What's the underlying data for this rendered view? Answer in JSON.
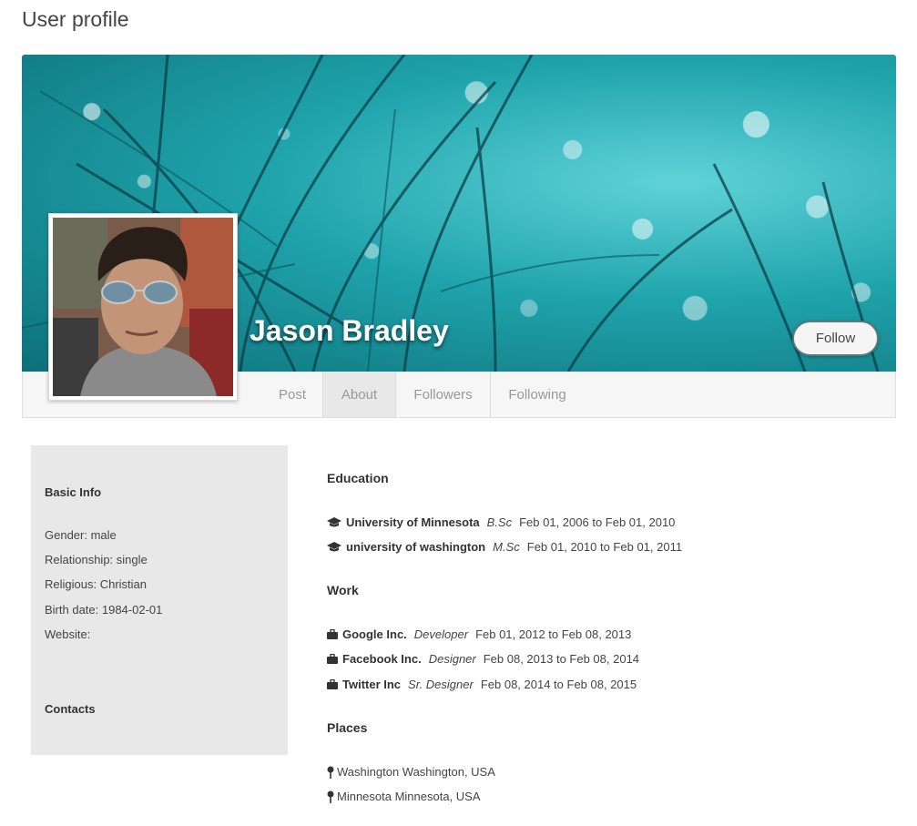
{
  "page": {
    "title": "User profile"
  },
  "profile": {
    "name": "Jason Bradley",
    "follow_label": "Follow"
  },
  "tabs": [
    {
      "label": "Post",
      "active": false
    },
    {
      "label": "About",
      "active": true
    },
    {
      "label": "Followers",
      "active": false
    },
    {
      "label": "Following",
      "active": false
    }
  ],
  "sidebar": {
    "basic_info_heading": "Basic Info",
    "gender": "Gender: male",
    "relationship": "Relationship: single",
    "religious": "Religious: Christian",
    "birth_date": "Birth date: 1984-02-01",
    "website": "Website:",
    "contacts_heading": "Contacts"
  },
  "education": {
    "heading": "Education",
    "items": [
      {
        "school": "University of Minnesota",
        "degree": "B.Sc",
        "dates": "Feb 01, 2006 to Feb 01, 2010"
      },
      {
        "school": "university of washington",
        "degree": "M.Sc",
        "dates": "Feb 01, 2010 to Feb 01, 2011"
      }
    ]
  },
  "work": {
    "heading": "Work",
    "items": [
      {
        "company": "Google Inc.",
        "role": "Developer",
        "dates": "Feb 01, 2012 to Feb 08, 2013"
      },
      {
        "company": "Facebook Inc.",
        "role": "Designer",
        "dates": "Feb 08, 2013 to Feb 08, 2014"
      },
      {
        "company": "Twitter Inc",
        "role": "Sr. Designer",
        "dates": "Feb 08, 2014 to Feb 08, 2015"
      }
    ]
  },
  "places": {
    "heading": "Places",
    "items": [
      {
        "label": "Washington Washington, USA"
      },
      {
        "label": "Minnesota Minnesota, USA"
      }
    ]
  },
  "icons": {
    "education": "graduation-cap-icon",
    "work": "briefcase-icon",
    "place": "map-pin-icon"
  },
  "colors": {
    "cover_teal": "#1fa3ab",
    "sidebar_bg": "#e8e8e8",
    "tab_active_bg": "#e8e8e8"
  }
}
